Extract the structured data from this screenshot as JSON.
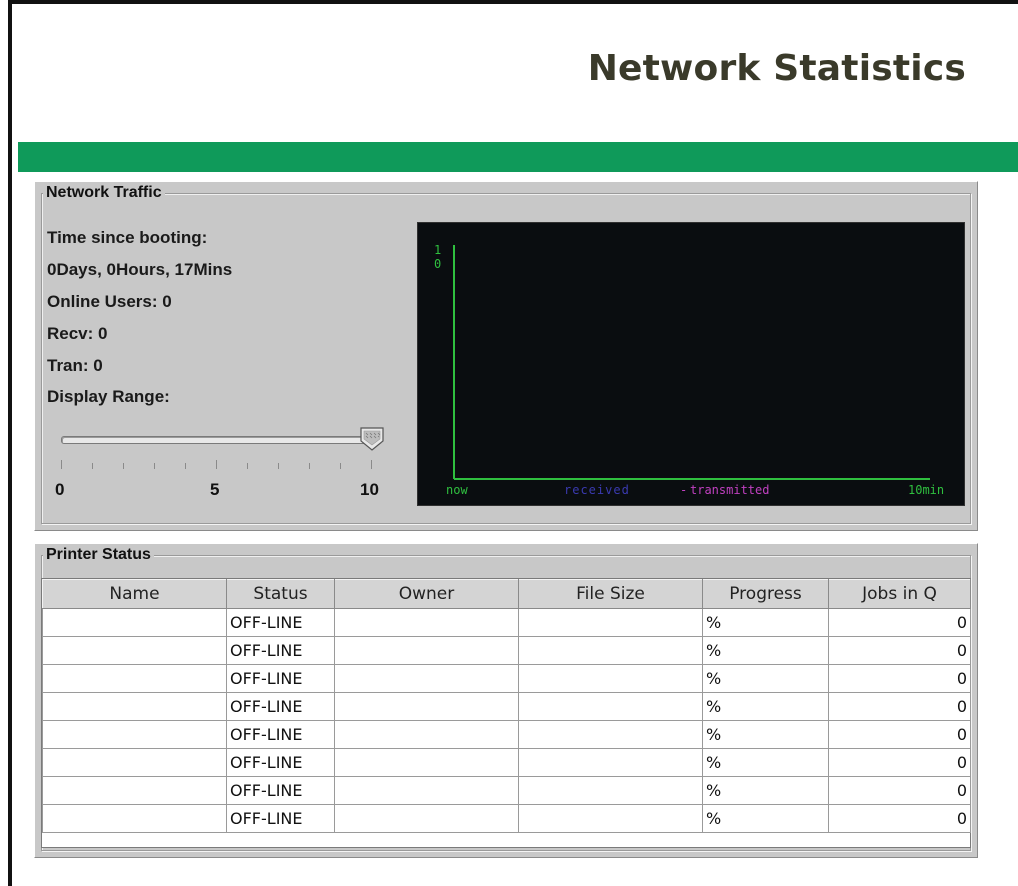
{
  "header": {
    "title": "Network Statistics"
  },
  "traffic": {
    "group_label": "Network Traffic",
    "time_label": "Time since booting:",
    "uptime": "0Days, 0Hours, 17Mins",
    "online_users": "Online Users: 0",
    "recv": "Recv: 0",
    "tran": "Tran: 0",
    "display_range_label": "Display Range:",
    "slider": {
      "min": 0,
      "max": 10,
      "value": 10,
      "label_min": "0",
      "label_mid": "5",
      "label_max": "10"
    },
    "graph": {
      "y_top": "1",
      "y_zero": "0",
      "x_start": "now",
      "legend_received": "received",
      "legend_transmitted": "transmitted",
      "x_end": "10min",
      "colors": {
        "axis": "#2fbf3f",
        "received": "#3a3ab0",
        "transmitted": "#c040c0",
        "background": "#0a0d10"
      }
    }
  },
  "printer": {
    "group_label": "Printer Status",
    "columns": [
      "Name",
      "Status",
      "Owner",
      "File Size",
      "Progress",
      "Jobs in Q"
    ],
    "rows": [
      {
        "name": "",
        "status": "OFF-LINE",
        "owner": "",
        "file_size": "",
        "progress": "%",
        "jobs": "0"
      },
      {
        "name": "",
        "status": "OFF-LINE",
        "owner": "",
        "file_size": "",
        "progress": "%",
        "jobs": "0"
      },
      {
        "name": "",
        "status": "OFF-LINE",
        "owner": "",
        "file_size": "",
        "progress": "%",
        "jobs": "0"
      },
      {
        "name": "",
        "status": "OFF-LINE",
        "owner": "",
        "file_size": "",
        "progress": "%",
        "jobs": "0"
      },
      {
        "name": "",
        "status": "OFF-LINE",
        "owner": "",
        "file_size": "",
        "progress": "%",
        "jobs": "0"
      },
      {
        "name": "",
        "status": "OFF-LINE",
        "owner": "",
        "file_size": "",
        "progress": "%",
        "jobs": "0"
      },
      {
        "name": "",
        "status": "OFF-LINE",
        "owner": "",
        "file_size": "",
        "progress": "%",
        "jobs": "0"
      },
      {
        "name": "",
        "status": "OFF-LINE",
        "owner": "",
        "file_size": "",
        "progress": "%",
        "jobs": "0"
      }
    ]
  },
  "colors": {
    "accent_bar": "#0f9a5a",
    "panel": "#c8c8c8",
    "title": "#3a3a2a"
  }
}
